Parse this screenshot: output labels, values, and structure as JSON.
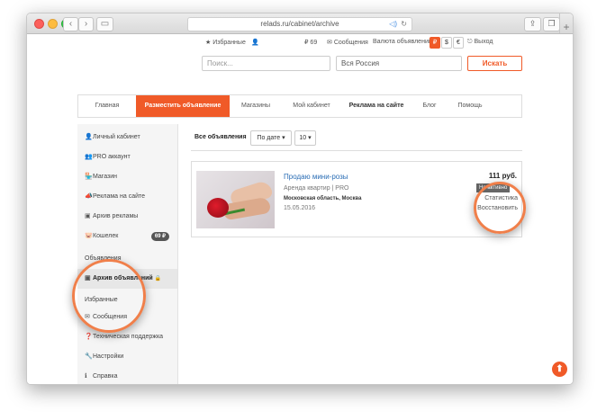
{
  "browser": {
    "url": "relads.ru/cabinet/archive",
    "buttons": {
      "back": "‹",
      "forward": "›",
      "sidebar": "▭",
      "share": "⇪",
      "tabs": "❐",
      "new_tab": "+"
    },
    "addr_icons": {
      "audio": "◁)",
      "reload": "↻"
    }
  },
  "topbar": {
    "favorites": "Избранные",
    "favorites_icon": "★",
    "user_icon": "👤",
    "points": "69",
    "points_icon": "₽",
    "messages": "Сообщения",
    "messages_icon": "✉",
    "currency_label": "Валюта объявлений:",
    "currencies": [
      "₽",
      "$",
      "€"
    ],
    "logout": "Выход",
    "logout_icon": "⎋"
  },
  "search": {
    "query_placeholder": "Поиск...",
    "region_value": "Вся Россия",
    "find_label": "Искать"
  },
  "menu": {
    "items": [
      {
        "label": "Главная"
      },
      {
        "label": "Разместить объявление"
      },
      {
        "label": "Магазины"
      },
      {
        "label": "Мой кабинет"
      },
      {
        "label": "Реклама на сайте"
      },
      {
        "label": "Блог"
      },
      {
        "label": "Помощь"
      }
    ]
  },
  "sidebar": {
    "items": [
      {
        "label": "Личный кабинет",
        "icon": "👤"
      },
      {
        "label": "PRO аккаунт",
        "icon": "👥"
      },
      {
        "label": "Магазин",
        "icon": "🏪"
      },
      {
        "label": "Реклама на сайте",
        "icon": "📣"
      },
      {
        "label": "Архив рекламы",
        "icon": "▣"
      },
      {
        "label": "Кошелек",
        "icon": "🐷",
        "badge": "69 ₽"
      },
      {
        "label": "Объявления",
        "icon": ""
      },
      {
        "label": "Архив объявлений",
        "icon": "▣",
        "lock": "🔒"
      },
      {
        "label": "Избранные",
        "icon": ""
      },
      {
        "label": "Сообщения",
        "icon": "✉"
      },
      {
        "label": "Техническая поддержка",
        "icon": "❓"
      },
      {
        "label": "Настройки",
        "icon": "🔧"
      },
      {
        "label": "Справка",
        "icon": "ℹ"
      }
    ]
  },
  "main": {
    "filter_label": "Все объявления",
    "sort_value": "По дате ▾",
    "per_page_value": "10 ▾",
    "ad": {
      "title": "Продаю мини-розы",
      "category": "Аренда квартир | PRO",
      "location": "Московская область, Москва",
      "date": "15.05.2016",
      "price": "111 руб.",
      "status": "Не активно",
      "stats_link": "Статистика",
      "restore_link": "Восстановить"
    }
  },
  "scroll_top_icon": "⬆",
  "colors": {
    "accent": "#f05a28",
    "link": "#2a6db5",
    "lens": "#f07f4a"
  }
}
